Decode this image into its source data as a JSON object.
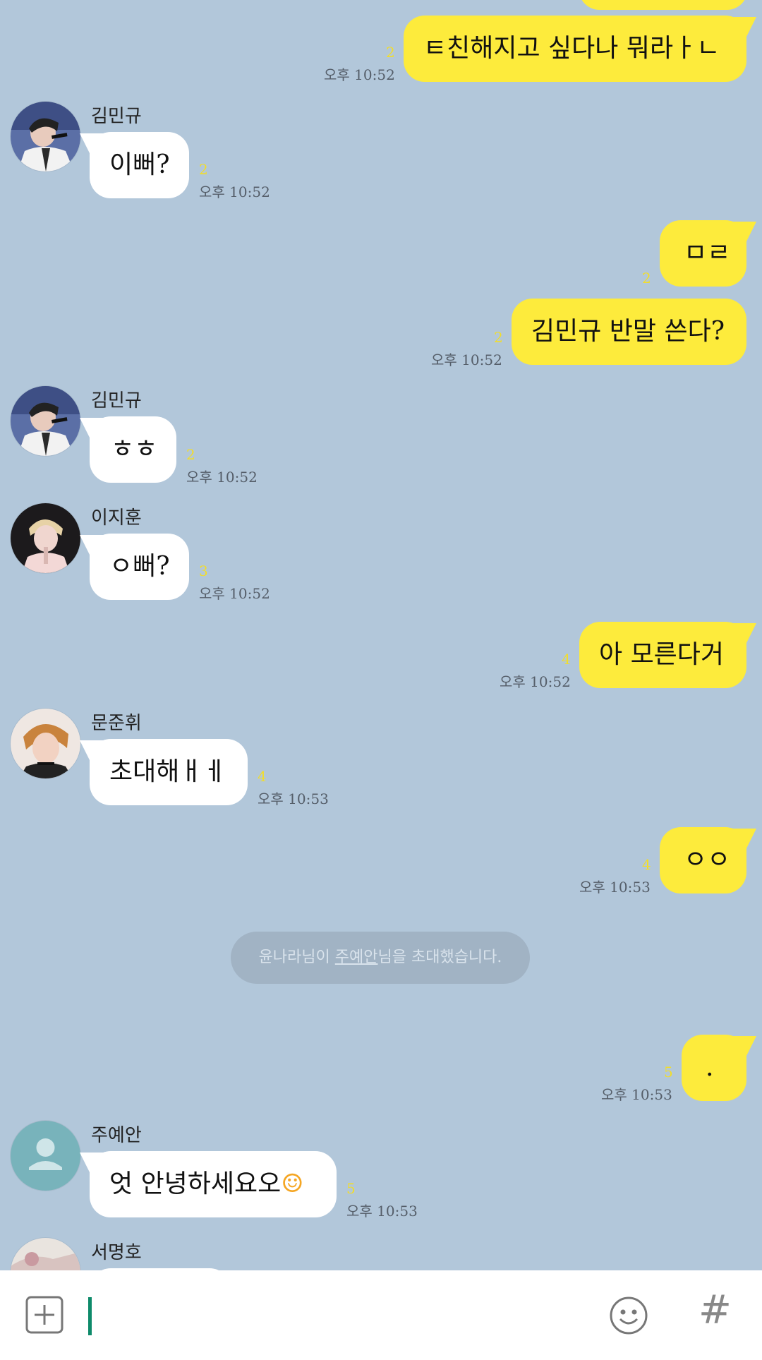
{
  "chat": {
    "msg1": {
      "text": "ㅌ친해지고 싶다나 뭐라ㅏㄴ",
      "unread": "2",
      "time": "오후 10:52"
    },
    "msg2": {
      "sender": "김민규",
      "text": "이뻐?",
      "unread": "2",
      "time": "오후 10:52"
    },
    "msg3": {
      "text": "ㅁㄹ",
      "unread": "2"
    },
    "msg4": {
      "text": "김민규 반말 쓴다?",
      "unread": "2",
      "time": "오후 10:52"
    },
    "msg5": {
      "sender": "김민규",
      "text": "ㅎㅎ",
      "unread": "2",
      "time": "오후 10:52"
    },
    "msg6": {
      "sender": "이지훈",
      "text": "ㅇ뻐?",
      "unread": "3",
      "time": "오후 10:52"
    },
    "msg7": {
      "text": "아 모른다거",
      "unread": "4",
      "time": "오후 10:52"
    },
    "msg8": {
      "sender": "문준휘",
      "text": "초대해ㅐㅔ",
      "unread": "4",
      "time": "오후 10:53"
    },
    "msg9": {
      "text": "ㅇㅇ",
      "unread": "4",
      "time": "오후 10:53"
    },
    "system": {
      "pre": "윤나라님이 ",
      "link": "주예안",
      "post": "님을 초대했습니다."
    },
    "msg10": {
      "text": ".",
      "unread": "5",
      "time": "오후 10:53"
    },
    "msg11": {
      "sender": "주예안",
      "text": "엇 안녕하세요오",
      "emoji": "☺",
      "unread": "5",
      "time": "오후 10:53"
    },
    "msg12": {
      "sender": "서명호"
    }
  },
  "input": {
    "plus_icon": "plus-square-icon",
    "emoji_icon": "smiley-icon",
    "hash_label": "#"
  },
  "colors": {
    "background": "#b2c7da",
    "outgoing_bubble": "#fdeb3c",
    "incoming_bubble": "#ffffff",
    "unread": "#f2dd2b"
  }
}
